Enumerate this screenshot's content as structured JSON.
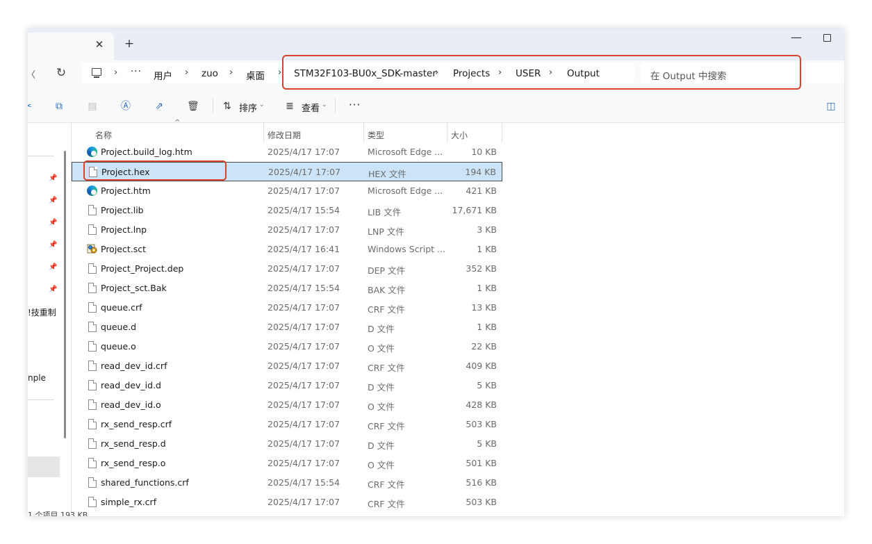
{
  "titlebar": {
    "close_tab": "✕",
    "new_tab": "+",
    "minimize": "—"
  },
  "nav": {
    "back": "〈",
    "refresh": "↻",
    "ellipsis": "···",
    "breadcrumb": [
      "用户",
      "zuo",
      "桌面",
      "STM32F103-BU0x_SDK-master",
      "Projects",
      "USER",
      "Output"
    ],
    "separator": "›",
    "search_placeholder": "在 Output 中搜索"
  },
  "toolbar": {
    "sort_label": "排序",
    "view_label": "查看",
    "more": "···",
    "icons": [
      "cut-icon",
      "copy-icon",
      "paste-icon",
      "rename-icon",
      "share-icon",
      "delete-icon",
      "sort-icon",
      "view-icon",
      "details-pane-icon"
    ]
  },
  "sidebar": {
    "fragments": [
      "!技重制",
      "nple"
    ]
  },
  "columns": {
    "name": "名称",
    "date": "修改日期",
    "type": "类型",
    "size": "大小"
  },
  "files": [
    {
      "name": "Project.build_log.htm",
      "date": "2025/4/17 17:07",
      "type": "Microsoft Edge ...",
      "size": "10 KB",
      "icon": "edge"
    },
    {
      "name": "Project.hex",
      "date": "2025/4/17 17:07",
      "type": "HEX 文件",
      "size": "194 KB",
      "icon": "doc",
      "selected": true
    },
    {
      "name": "Project.htm",
      "date": "2025/4/17 17:07",
      "type": "Microsoft Edge ...",
      "size": "421 KB",
      "icon": "edge"
    },
    {
      "name": "Project.lib",
      "date": "2025/4/17 15:54",
      "type": "LIB 文件",
      "size": "17,671 KB",
      "icon": "doc"
    },
    {
      "name": "Project.lnp",
      "date": "2025/4/17 17:07",
      "type": "LNP 文件",
      "size": "3 KB",
      "icon": "doc"
    },
    {
      "name": "Project.sct",
      "date": "2025/4/17 16:41",
      "type": "Windows Script ...",
      "size": "1 KB",
      "icon": "script"
    },
    {
      "name": "Project_Project.dep",
      "date": "2025/4/17 17:07",
      "type": "DEP 文件",
      "size": "352 KB",
      "icon": "doc"
    },
    {
      "name": "Project_sct.Bak",
      "date": "2025/4/17 15:54",
      "type": "BAK 文件",
      "size": "1 KB",
      "icon": "doc"
    },
    {
      "name": "queue.crf",
      "date": "2025/4/17 17:07",
      "type": "CRF 文件",
      "size": "13 KB",
      "icon": "doc"
    },
    {
      "name": "queue.d",
      "date": "2025/4/17 17:07",
      "type": "D 文件",
      "size": "1 KB",
      "icon": "doc"
    },
    {
      "name": "queue.o",
      "date": "2025/4/17 17:07",
      "type": "O 文件",
      "size": "22 KB",
      "icon": "doc"
    },
    {
      "name": "read_dev_id.crf",
      "date": "2025/4/17 17:07",
      "type": "CRF 文件",
      "size": "409 KB",
      "icon": "doc"
    },
    {
      "name": "read_dev_id.d",
      "date": "2025/4/17 17:07",
      "type": "D 文件",
      "size": "5 KB",
      "icon": "doc"
    },
    {
      "name": "read_dev_id.o",
      "date": "2025/4/17 17:07",
      "type": "O 文件",
      "size": "428 KB",
      "icon": "doc"
    },
    {
      "name": "rx_send_resp.crf",
      "date": "2025/4/17 17:07",
      "type": "CRF 文件",
      "size": "503 KB",
      "icon": "doc"
    },
    {
      "name": "rx_send_resp.d",
      "date": "2025/4/17 17:07",
      "type": "D 文件",
      "size": "5 KB",
      "icon": "doc"
    },
    {
      "name": "rx_send_resp.o",
      "date": "2025/4/17 17:07",
      "type": "O 文件",
      "size": "501 KB",
      "icon": "doc"
    },
    {
      "name": "shared_functions.crf",
      "date": "2025/4/17 15:54",
      "type": "CRF 文件",
      "size": "516 KB",
      "icon": "doc"
    },
    {
      "name": "simple_rx.crf",
      "date": "2025/4/17 17:07",
      "type": "CRF 文件",
      "size": "503 KB",
      "icon": "doc"
    }
  ],
  "status": {
    "text": "1 个项目 193 KB"
  },
  "colors": {
    "highlight": "#d9422c",
    "selection": "#cce4f7",
    "accent": "#2b6bc4"
  }
}
